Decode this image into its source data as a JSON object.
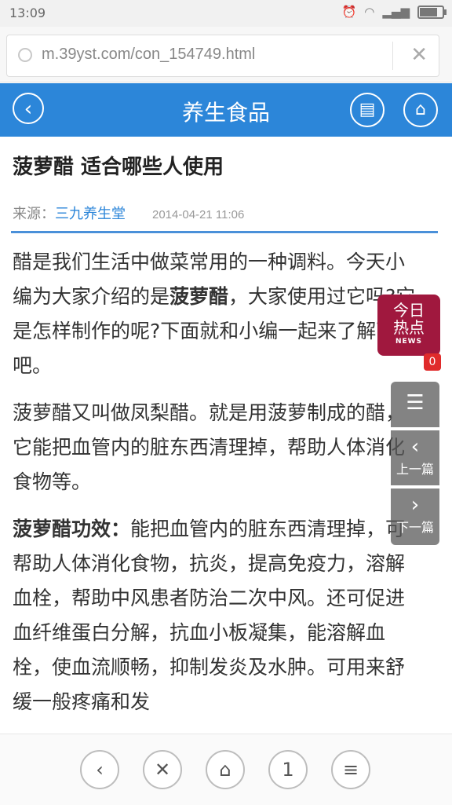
{
  "status": {
    "time": "13:09"
  },
  "browser": {
    "url": "m.39yst.com/con_154749.html",
    "close_glyph": "✕"
  },
  "header": {
    "title": "养生食品",
    "back_glyph": "‹",
    "list_glyph": "▤",
    "home_glyph": "⌂"
  },
  "article": {
    "title": "菠萝醋 适合哪些人使用",
    "source_label": "来源：",
    "source_name": "三九养生堂",
    "date": "2014-04-21 11:06",
    "p1_a": "醋是我们生活中做菜常用的一种调料。今天小编为大家介绍的是",
    "p1_bold": "菠萝醋",
    "p1_b": "，大家使用过它吗?它是怎样制作的呢?下面就和小编一起来了解下吧。",
    "p2": "菠萝醋又叫做凤梨醋。就是用菠萝制成的醋，它能把血管内的脏东西清理掉，帮助人体消化食物等。",
    "p3_bold": "菠萝醋功效：",
    "p3": "能把血管内的脏东西清理掉，可帮助人体消化食物，抗炎，提高免疫力，溶解血栓，帮助中风患者防治二次中风。还可促进血纤维蛋白分解，抗血小板凝集，能溶解血栓，使血流顺畅，抑制发炎及水肿。可用来舒缓一般疼痛和发"
  },
  "news_badge": {
    "line1": "今日",
    "line2": "热点",
    "tag": "NEWS",
    "count": "0"
  },
  "side": {
    "comment_glyph": "☰",
    "prev_glyph": "‹",
    "prev_label": "上一篇",
    "next_glyph": "›",
    "next_label": "下一篇"
  },
  "bottom": {
    "back": "‹",
    "close": "✕",
    "home": "⌂",
    "tabs": "1",
    "menu": "≡"
  },
  "colors": {
    "header": "#2c86d9",
    "news": "#a0183e"
  }
}
